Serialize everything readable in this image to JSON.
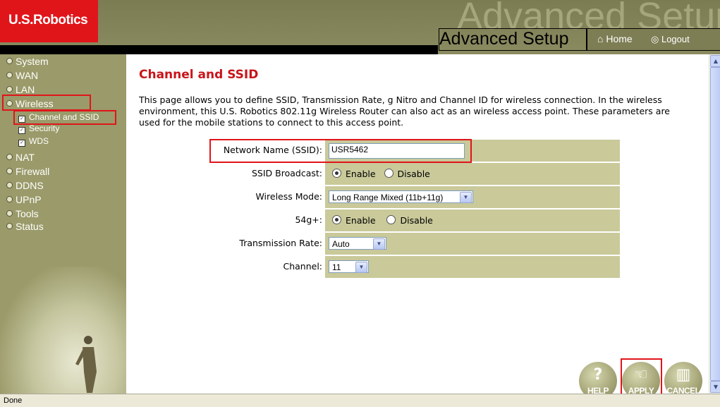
{
  "brand": {
    "logo_text": "U.S.Robotics",
    "watermark": "Advanced Setup",
    "title": "Advanced Setup"
  },
  "nav": {
    "home": "Home",
    "logout": "Logout"
  },
  "sidebar": {
    "items": [
      {
        "label": "System"
      },
      {
        "label": "WAN"
      },
      {
        "label": "LAN"
      },
      {
        "label": "Wireless"
      },
      {
        "label": "NAT"
      },
      {
        "label": "Firewall"
      },
      {
        "label": "DDNS"
      },
      {
        "label": "UPnP"
      },
      {
        "label": "Tools"
      },
      {
        "label": "Status"
      }
    ],
    "subitems": [
      {
        "label": "Channel and SSID"
      },
      {
        "label": "Security"
      },
      {
        "label": "WDS"
      }
    ]
  },
  "page": {
    "title": "Channel and SSID",
    "description": "This page allows you to define SSID, Transmission Rate, g Nitro and Channel ID for wireless connection.  In the wireless environment, this U.S. Robotics 802.11g Wireless Router can also act as an wireless access point.  These parameters are used for the mobile stations to connect to this access point."
  },
  "form": {
    "ssid": {
      "label": "Network Name (SSID):",
      "value": "USR5462"
    },
    "broadcast": {
      "label": "SSID Broadcast:",
      "enable": "Enable",
      "disable": "Disable",
      "selected": "Enable"
    },
    "mode": {
      "label": "Wireless Mode:",
      "value": "Long Range Mixed (11b+11g)"
    },
    "g54": {
      "label": "54g+:",
      "enable": "Enable",
      "disable": "Disable",
      "selected": "Enable"
    },
    "rate": {
      "label": "Transmission Rate:",
      "value": "Auto"
    },
    "channel": {
      "label": "Channel:",
      "value": "11"
    }
  },
  "buttons": {
    "help": "HELP",
    "apply": "APPLY",
    "cancel": "CANCEL"
  },
  "status": {
    "text": "Done"
  },
  "colors": {
    "header": "#7c7c53",
    "sidebar": "#9a9a6a",
    "accent": "#c8151a",
    "form_bg": "#c9c99a",
    "logo_bg": "#e0151a"
  }
}
